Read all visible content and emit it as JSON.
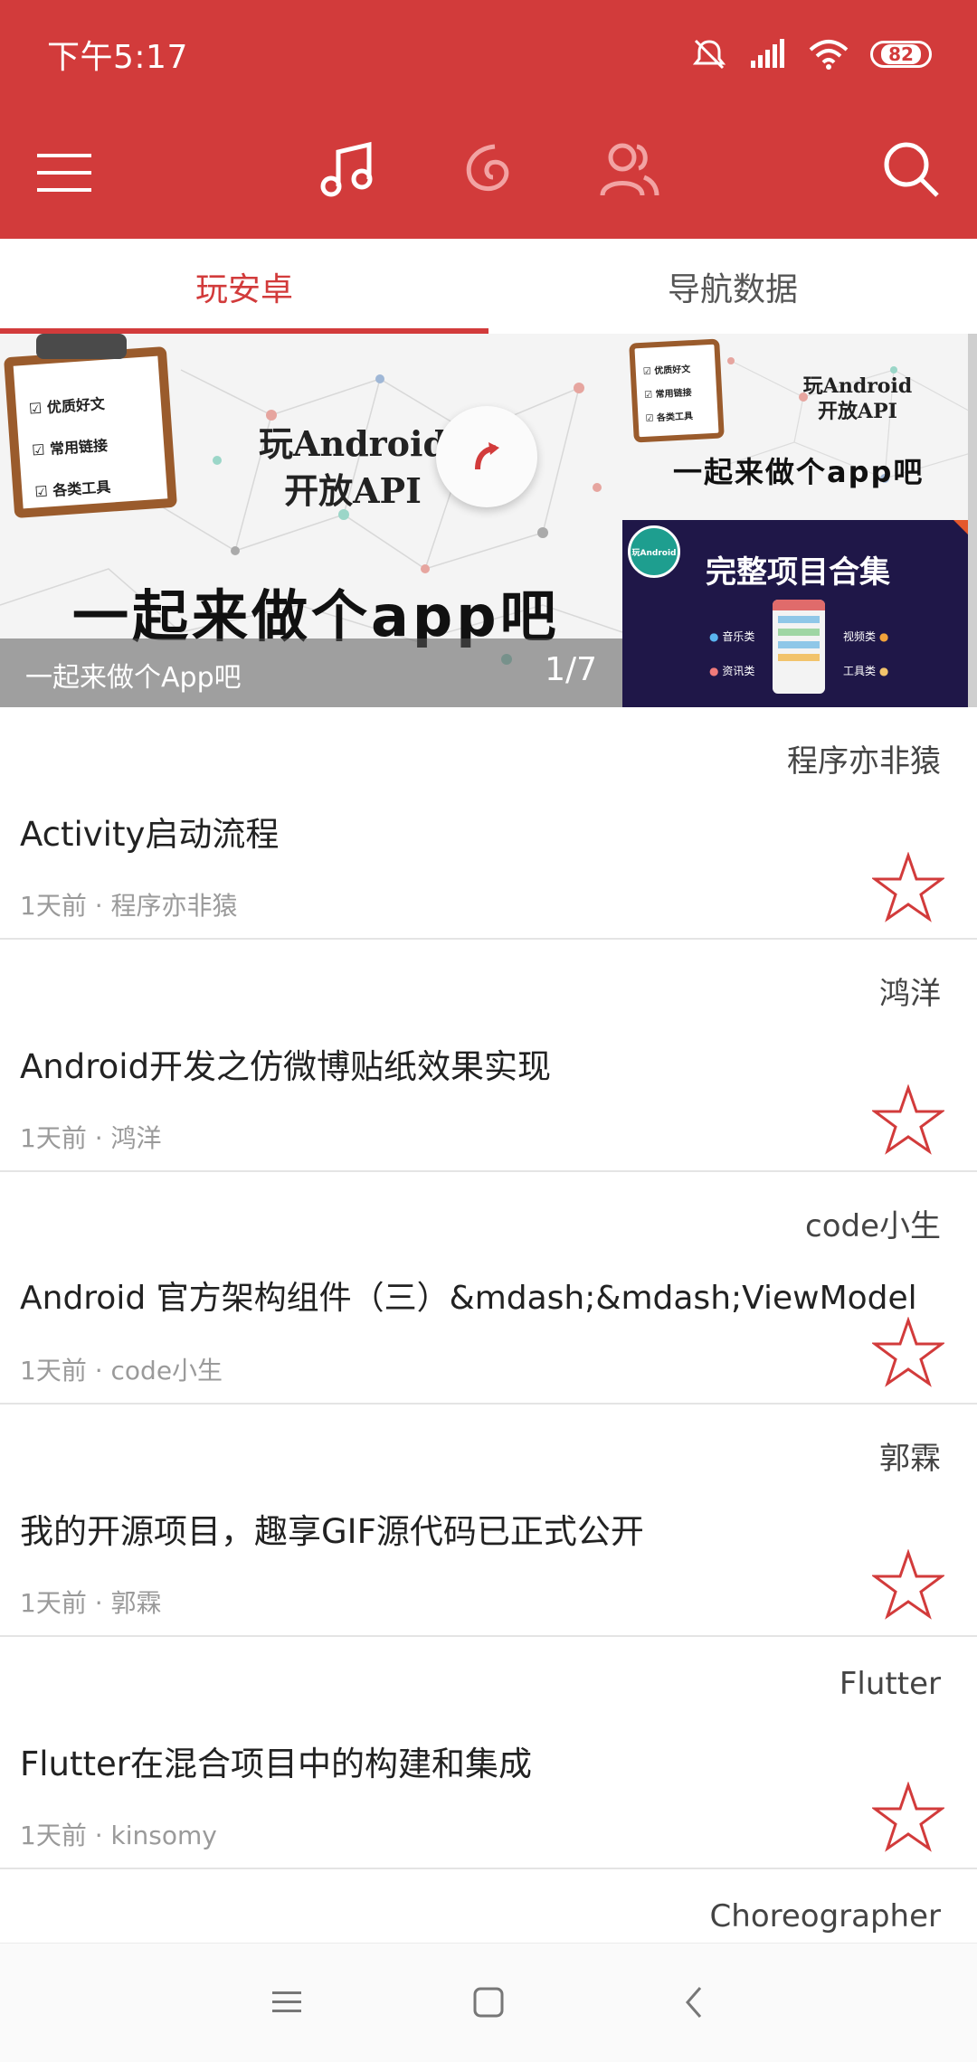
{
  "status_bar": {
    "time": "下午5:17",
    "battery": "82"
  },
  "toolbar": {
    "menu_icon": "menu-icon",
    "tabs_icons": [
      "music-note-icon",
      "netease-icon",
      "friends-icon"
    ],
    "search_icon": "search-icon"
  },
  "tabs": [
    {
      "label": "玩安卓",
      "active": true
    },
    {
      "label": "导航数据",
      "active": false
    }
  ],
  "banner": {
    "caption": "一起来做个App吧",
    "index": "1/7",
    "main": {
      "checklist": [
        "优质好文",
        "常用链接",
        "各类工具"
      ],
      "title_line1": "玩Android",
      "title_line2": "开放API",
      "slogan": "一起来做个app吧"
    },
    "side_top": {
      "checklist": [
        "优质好文",
        "常用链接",
        "各类工具"
      ],
      "title_line1": "玩Android",
      "title_line2": "开放API",
      "slogan": "一起来做个app吧"
    },
    "side_bottom": {
      "badge": "玩Android",
      "title": "完整项目合集",
      "labels": [
        "音乐类",
        "资讯类",
        "视频类",
        "工具类"
      ]
    }
  },
  "articles": [
    {
      "chapter": "程序亦非猿",
      "title": "Activity启动流程",
      "meta": "1天前 · 程序亦非猿"
    },
    {
      "chapter": "鸿洋",
      "title": "Android开发之仿微博贴纸效果实现",
      "meta": "1天前 · 鸿洋"
    },
    {
      "chapter": "code小生",
      "title": "Android 官方架构组件（三）&mdash;&mdash;ViewModel",
      "meta": "1天前 · code小生"
    },
    {
      "chapter": "郭霖",
      "title": "我的开源项目，趣享GIF源代码已正式公开",
      "meta": "1天前 · 郭霖"
    },
    {
      "chapter": "Flutter",
      "title": "Flutter在混合项目中的构建和集成",
      "meta": "1天前 ·  kinsomy"
    },
    {
      "chapter": "Choreographer",
      "title": "",
      "meta": ""
    }
  ],
  "colors": {
    "primary": "#d23b3b",
    "star": "#d23b3b"
  }
}
